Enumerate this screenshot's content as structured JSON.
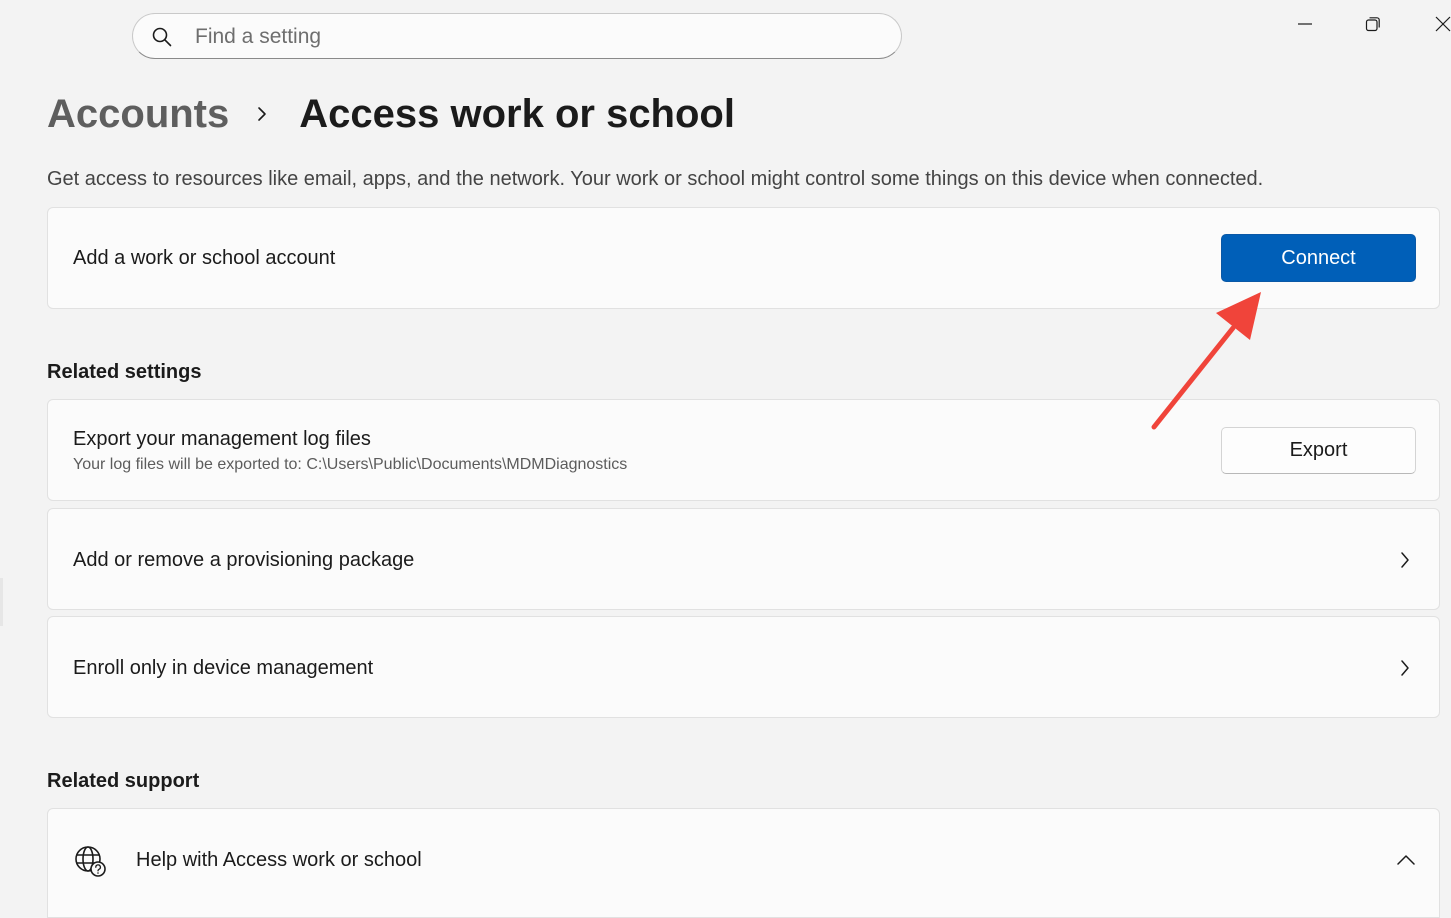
{
  "search": {
    "placeholder": "Find a setting",
    "value": ""
  },
  "window_controls": {
    "minimize_icon": "minimize-icon",
    "restore_icon": "restore-icon",
    "close_icon": "close-icon"
  },
  "breadcrumb": {
    "parent": "Accounts",
    "current": "Access work or school"
  },
  "description": "Get access to resources like email, apps, and the network. Your work or school might control some things on this device when connected.",
  "add_account": {
    "label": "Add a work or school account",
    "button": "Connect"
  },
  "related_settings": {
    "title": "Related settings",
    "export": {
      "label": "Export your management log files",
      "sub": "Your log files will be exported to: C:\\Users\\Public\\Documents\\MDMDiagnostics",
      "button": "Export"
    },
    "provisioning": {
      "label": "Add or remove a provisioning package"
    },
    "enroll": {
      "label": "Enroll only in device management"
    }
  },
  "related_support": {
    "title": "Related support",
    "help": {
      "label": "Help with Access work or school",
      "icon": "globe-help-icon"
    }
  },
  "colors": {
    "accent": "#005fb8",
    "annotation_arrow": "#f0443a",
    "background": "#f3f3f3",
    "card": "#fbfbfb"
  }
}
